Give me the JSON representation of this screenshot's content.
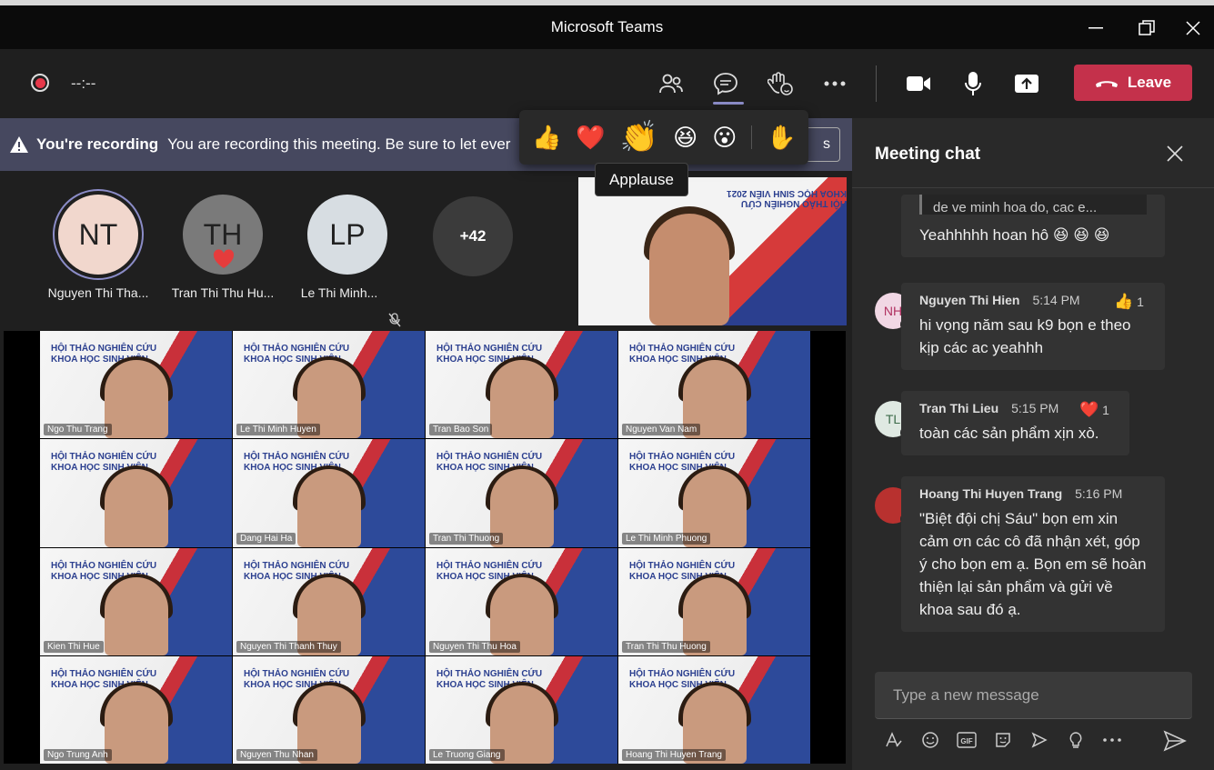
{
  "window": {
    "title": "Microsoft Teams"
  },
  "toolbar": {
    "timer": "--:--",
    "leave_label": "Leave"
  },
  "banner": {
    "bold": "You're recording",
    "text": "You are recording this meeting. Be sure to let ever",
    "dismiss_tail": "s"
  },
  "reactions": {
    "items": [
      "👍",
      "❤️",
      "👏",
      "😆",
      "😮",
      "✋"
    ],
    "tooltip": "Applause"
  },
  "participants": [
    {
      "initials": "NT",
      "name": "Nguyen Thi Tha...",
      "color": "#f1d7cd"
    },
    {
      "initials": "TH",
      "name": "Tran Thi Thu Hu...",
      "color": "#7a7a7a"
    },
    {
      "initials": "LP",
      "name": "Le Thi Minh...",
      "color": "#d7dde2"
    }
  ],
  "more_count": "+42",
  "selfview_banner": "HỘI THẢO NGHIÊN CỨU KHOA HỌC SINH VIÊN 2021",
  "grid_logo": "HỘI THẢO NGHIÊN CỨU\nKHOA HỌC SINH VIÊN",
  "grid": [
    "Ngo Thu Trang",
    "Le Thi Minh Huyen",
    "Tran Bao Son",
    "Nguyen Van Nam",
    "",
    "Dang Hai Ha",
    "Tran Thi Thuong",
    "Le Thi Minh Phuong",
    "Kien Thi Hue",
    "Nguyen Thi Thanh Thuy",
    "Nguyen Thi Thu Hoa",
    "Tran Thi Thu Huong",
    "Ngo Trung Anh",
    "Nguyen Thu Nhan",
    "Le Truong Giang",
    "Hoang Thi Huyen Trang"
  ],
  "chat": {
    "title": "Meeting chat",
    "messages": [
      {
        "quote": "de ve minh hoa do, cac e...",
        "text": "Yeahhhhh hoan hô 😆 😆 😆"
      },
      {
        "initials": "NH",
        "author": "Nguyen Thi Hien",
        "time": "5:14 PM",
        "react": "👍",
        "react_count": "1",
        "text": "hi vọng năm sau k9 bọn e theo kịp các ac yeahhh",
        "av_color": "#f1d7e4",
        "av_text": "#b03060"
      },
      {
        "initials": "TL",
        "author": "Tran Thi Lieu",
        "time": "5:15 PM",
        "react": "❤️",
        "react_count": "1",
        "text": "toàn các sản phẩm xịn xò.",
        "av_color": "#dfe9e2",
        "av_text": "#3c6b4a"
      },
      {
        "initials": "",
        "author": "Hoang Thi Huyen Trang",
        "time": "5:16 PM",
        "text": "\"Biệt đội chị Sáu\" bọn em xin cảm ơn các cô đã nhận xét, góp ý cho bọn em ạ. Bọn em sẽ hoàn thiện lại sản phẩm và gửi về khoa sau đó ạ.",
        "av_color": "#b8312f",
        "av_text": "#fff"
      }
    ],
    "placeholder": "Type a new message"
  },
  "compose_tools": [
    "format-icon",
    "emoji-icon",
    "GIF",
    "sticker-icon",
    "meet-now-icon",
    "praise-icon",
    "more-icon"
  ]
}
